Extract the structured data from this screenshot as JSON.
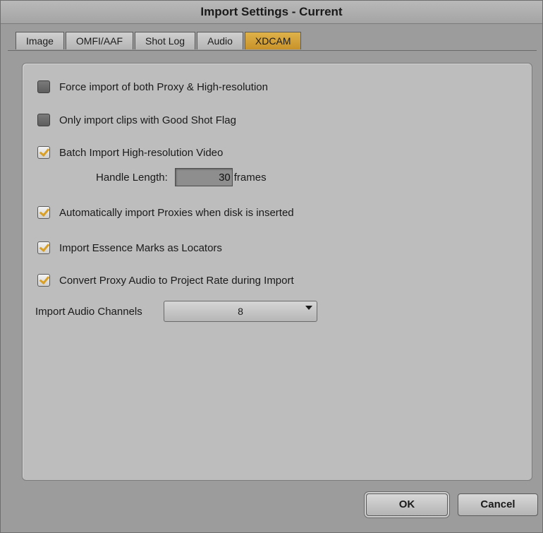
{
  "window": {
    "title": "Import Settings - Current"
  },
  "tabs": [
    {
      "label": "Image",
      "active": false
    },
    {
      "label": "OMFI/AAF",
      "active": false
    },
    {
      "label": "Shot Log",
      "active": false
    },
    {
      "label": "Audio",
      "active": false
    },
    {
      "label": "XDCAM",
      "active": true
    }
  ],
  "options": [
    {
      "label": "Force import of both Proxy & High-resolution",
      "checked": false
    },
    {
      "label": "Only import clips with Good Shot Flag",
      "checked": false
    },
    {
      "label": "Batch Import High-resolution Video",
      "checked": true
    },
    {
      "label": "Automatically import Proxies when disk is inserted",
      "checked": true
    },
    {
      "label": "Import Essence Marks as Locators",
      "checked": true
    },
    {
      "label": "Convert Proxy Audio to Project Rate during Import",
      "checked": true
    }
  ],
  "handle": {
    "label": "Handle Length:",
    "value": "30",
    "unit": "frames"
  },
  "audio_channels": {
    "label": "Import Audio Channels",
    "value": "8"
  },
  "buttons": {
    "ok": "OK",
    "cancel": "Cancel"
  },
  "colors": {
    "accent": "#d8a028",
    "active_tab": "#d0a03a",
    "panel": "#bdbdbd",
    "background": "#9c9c9c"
  }
}
